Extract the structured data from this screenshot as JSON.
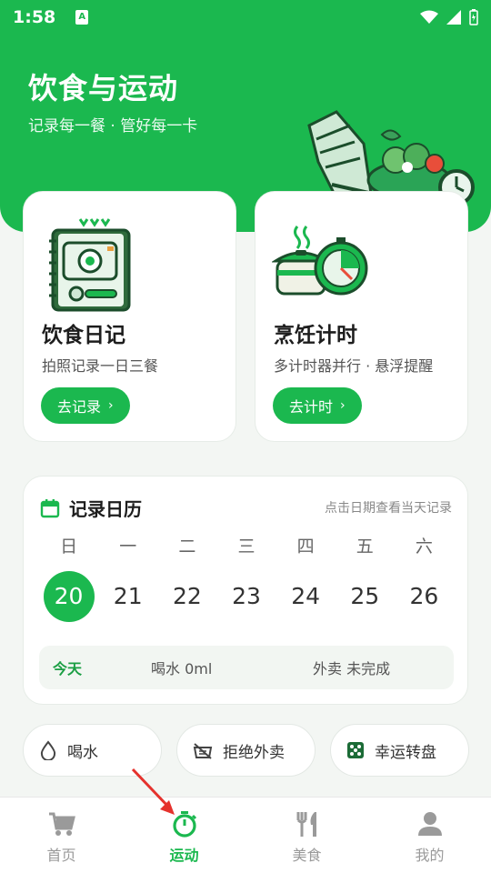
{
  "status": {
    "time": "1:58",
    "note": "A"
  },
  "hero": {
    "title": "饮食与运动",
    "subtitle": "记录每一餐 · 管好每一卡"
  },
  "cards": [
    {
      "title": "饮食日记",
      "desc": "拍照记录一日三餐",
      "button": "去记录"
    },
    {
      "title": "烹饪计时",
      "desc": "多计时器并行 · 悬浮提醒",
      "button": "去计时"
    }
  ],
  "calendar": {
    "title": "记录日历",
    "hint": "点击日期查看当天记录",
    "weekdays": [
      "日",
      "一",
      "二",
      "三",
      "四",
      "五",
      "六"
    ],
    "days": [
      "20",
      "21",
      "22",
      "23",
      "24",
      "25",
      "26"
    ],
    "selected_day": "20",
    "today_label": "今天",
    "water": "喝水 0ml",
    "takeout": "外卖 未完成"
  },
  "quick": [
    {
      "label": "喝水",
      "icon": "water-drop-icon"
    },
    {
      "label": "拒绝外卖",
      "icon": "no-takeout-icon"
    },
    {
      "label": "幸运转盘",
      "icon": "dice-icon"
    }
  ],
  "tabs": [
    {
      "label": "首页",
      "icon": "cart-icon",
      "active": false
    },
    {
      "label": "运动",
      "icon": "stopwatch-icon",
      "active": true
    },
    {
      "label": "美食",
      "icon": "fork-knife-icon",
      "active": false
    },
    {
      "label": "我的",
      "icon": "person-icon",
      "active": false
    }
  ],
  "colors": {
    "accent": "#1bb84f",
    "background": "#f3f6f3"
  }
}
